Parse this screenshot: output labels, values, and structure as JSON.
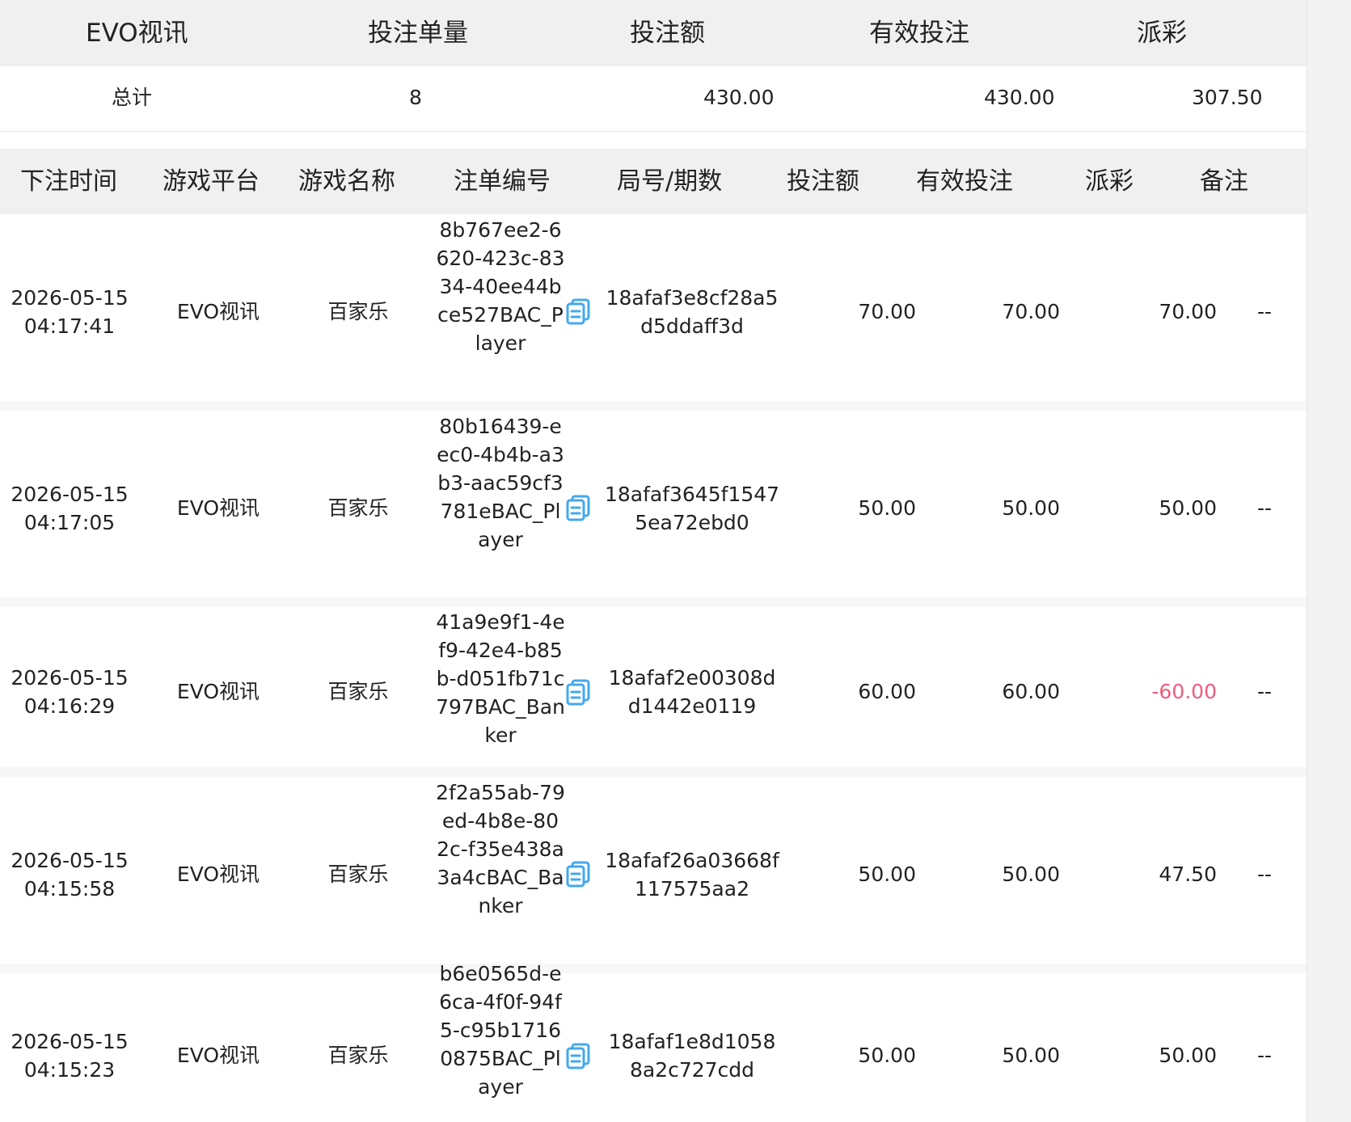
{
  "summary": {
    "headers": [
      "EVO视讯",
      "投注单量",
      "投注额",
      "有效投注",
      "派彩"
    ],
    "total": {
      "label": "总计",
      "count": "8",
      "bet_amount": "430.00",
      "valid_bet": "430.00",
      "payout": "307.50"
    }
  },
  "table": {
    "headers": [
      "下注时间",
      "游戏平台",
      "游戏名称",
      "注单编号",
      "局号/期数",
      "投注额",
      "有效投注",
      "派彩",
      "备注"
    ],
    "rows": [
      {
        "time": "2026-05-15 04:17:41",
        "platform": "EVO视讯",
        "game": "百家乐",
        "order_id": "8b767ee2-6620-423c-8334-40ee44bce527BAC_Player",
        "round": "18afaf3e8cf28a5d5ddaff3d",
        "bet": "70.00",
        "valid": "70.00",
        "payout": "70.00",
        "remark": "--"
      },
      {
        "time": "2026-05-15 04:17:05",
        "platform": "EVO视讯",
        "game": "百家乐",
        "order_id": "80b16439-eec0-4b4b-a3b3-aac59cf3781eBAC_Player",
        "round": "18afaf3645f15475ea72ebd0",
        "bet": "50.00",
        "valid": "50.00",
        "payout": "50.00",
        "remark": "--"
      },
      {
        "time": "2026-05-15 04:16:29",
        "platform": "EVO视讯",
        "game": "百家乐",
        "order_id": "41a9e9f1-4ef9-42e4-b85b-d051fb71c797BAC_Banker",
        "round": "18afaf2e00308dd1442e0119",
        "bet": "60.00",
        "valid": "60.00",
        "payout": "-60.00",
        "remark": "--"
      },
      {
        "time": "2026-05-15 04:15:58",
        "platform": "EVO视讯",
        "game": "百家乐",
        "order_id": "2f2a55ab-79ed-4b8e-802c-f35e438a3a4cBAC_Banker",
        "round": "18afaf26a03668f117575aa2",
        "bet": "50.00",
        "valid": "50.00",
        "payout": "47.50",
        "remark": "--"
      },
      {
        "time": "2026-05-15 04:15:23",
        "platform": "EVO视讯",
        "game": "百家乐",
        "order_id": "b6e0565d-e6ca-4f0f-94f5-c95b17160875BAC_Player",
        "round": "18afaf1e8d10588a2c727cdd",
        "bet": "50.00",
        "valid": "50.00",
        "payout": "50.00",
        "remark": "--"
      }
    ]
  },
  "theme": {
    "negative": "#ef5c7c",
    "icon": "#43a8ee",
    "header_bg": "#f0f0f0"
  },
  "icons": {
    "copy": "copy-icon"
  }
}
